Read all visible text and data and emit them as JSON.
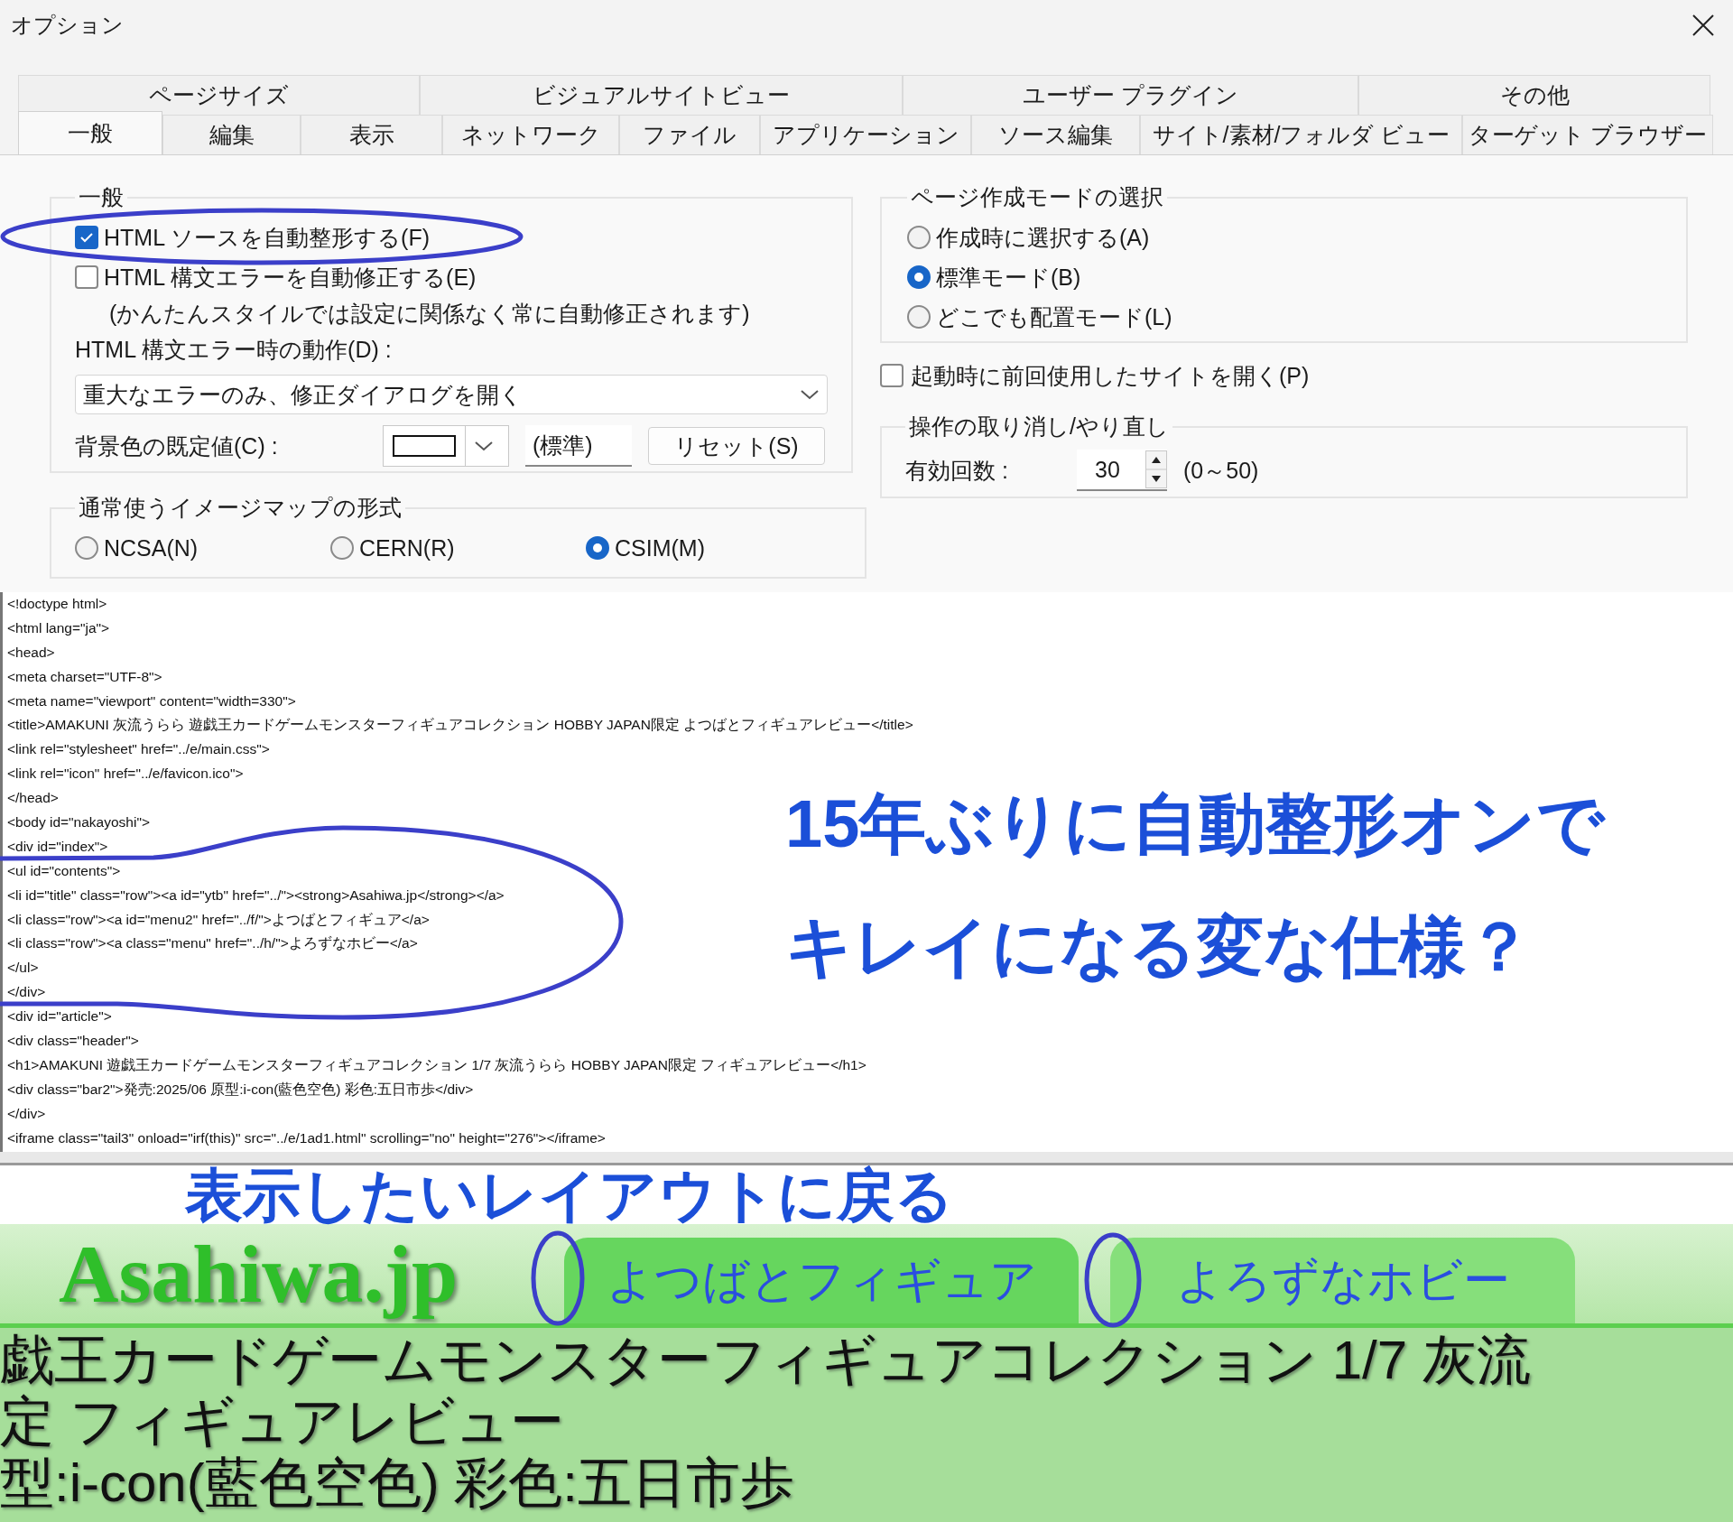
{
  "window": {
    "title": "オプション"
  },
  "tabs": {
    "row_1": [
      {
        "label": "ページサイズ",
        "selected": false
      },
      {
        "label": "ビジュアルサイトビュー",
        "selected": false
      },
      {
        "label": "ユーザー プラグイン",
        "selected": false
      },
      {
        "label": "その他",
        "selected": false
      }
    ],
    "row_2": [
      {
        "label": "一般",
        "selected": true
      },
      {
        "label": "編集",
        "selected": false
      },
      {
        "label": "表示",
        "selected": false
      },
      {
        "label": "ネットワーク",
        "selected": false
      },
      {
        "label": "ファイル",
        "selected": false
      },
      {
        "label": "アプリケーション",
        "selected": false
      },
      {
        "label": "ソース編集",
        "selected": false
      },
      {
        "label": "サイト/素材/フォルダ ビュー",
        "selected": false
      },
      {
        "label": "ターゲット ブラウザー",
        "selected": false
      }
    ]
  },
  "general_group": {
    "title": "一般",
    "auto_format": {
      "label": "HTML ソースを自動整形する(F)",
      "checked": true
    },
    "auto_fix": {
      "label": "HTML 構文エラーを自動修正する(E)",
      "checked": false
    },
    "note": "(かんたんスタイルでは設定に関係なく常に自動修正されます)",
    "error_action": {
      "label": "HTML 構文エラー時の動作(D) :",
      "value": "重大なエラーのみ、修正ダイアログを開く"
    },
    "background": {
      "label": "背景色の既定値(C) :",
      "standard": "(標準)",
      "reset": "リセット(S)"
    }
  },
  "imagemap_group": {
    "title": "通常使うイメージマップの形式",
    "options": [
      {
        "label": "NCSA(N)",
        "selected": false
      },
      {
        "label": "CERN(R)",
        "selected": false
      },
      {
        "label": "CSIM(M)",
        "selected": true
      }
    ]
  },
  "page_mode_group": {
    "title": "ページ作成モードの選択",
    "options": [
      {
        "label": "作成時に選択する(A)",
        "selected": false
      },
      {
        "label": "標準モード(B)",
        "selected": true
      },
      {
        "label": "どこでも配置モード(L)",
        "selected": false
      }
    ]
  },
  "open_last_site": {
    "label": "起動時に前回使用したサイトを開く(P)",
    "checked": false
  },
  "undo_group": {
    "title": "操作の取り消し/やり直し",
    "label": "有効回数 :",
    "value": "30",
    "range": "(0～50)"
  },
  "source_code": {
    "lines": [
      "<!doctype html>",
      "<html lang=\"ja\">",
      "<head>",
      "<meta charset=\"UTF-8\">",
      "<meta name=\"viewport\" content=\"width=330\">",
      "<title>AMAKUNI 灰流うらら 遊戯王カードゲームモンスターフィギュアコレクション HOBBY JAPAN限定 よつばとフィギュアレビュー</title>",
      "<link rel=\"stylesheet\" href=\"../e/main.css\">",
      "<link rel=\"icon\" href=\"../e/favicon.ico\">",
      "</head>",
      "<body id=\"nakayoshi\">",
      "<div id=\"index\">",
      "<ul id=\"contents\">",
      "<li id=\"title\" class=\"row\"><a id=\"ytb\" href=\"../\"><strong>Asahiwa.jp</strong></a>",
      "<li class=\"row\"><a id=\"menu2\" href=\"../f/\">よつばとフィギュア</a>",
      "<li class=\"row\"><a class=\"menu\" href=\"../h/\">よろずなホビー</a>",
      "</ul>",
      "</div>",
      "<div id=\"article\">",
      "<div class=\"header\">",
      "<h1>AMAKUNI 遊戯王カードゲームモンスターフィギュアコレクション 1/7 灰流うらら HOBBY JAPAN限定 フィギュアレビュー</h1>",
      "<div class=\"bar2\">発売:2025/06 原型:i-con(藍色空色) 彩色:五日市歩</div>",
      "</div>",
      "<iframe class=\"tail3\" onload=\"irf(this)\" src=\"../e/1ad1.html\" scrolling=\"no\" height=\"276\"></iframe>"
    ]
  },
  "annotations": [
    "15年ぶりに自動整形オンで",
    "キレイになる変な仕様？",
    "表示したいレイアウトに戻る"
  ],
  "site_preview": {
    "logo": "Asahiwa.jp",
    "menu": [
      {
        "label": "よつばとフィギュア",
        "selected": true
      },
      {
        "label": "よろずなホビー",
        "selected": false
      }
    ],
    "header_lines": [
      "戯王カードゲームモンスターフィギュアコレクション 1/7 灰流",
      "定 フィギュアレビュー",
      "型:i-con(藍色空色) 彩色:五日市歩"
    ]
  }
}
